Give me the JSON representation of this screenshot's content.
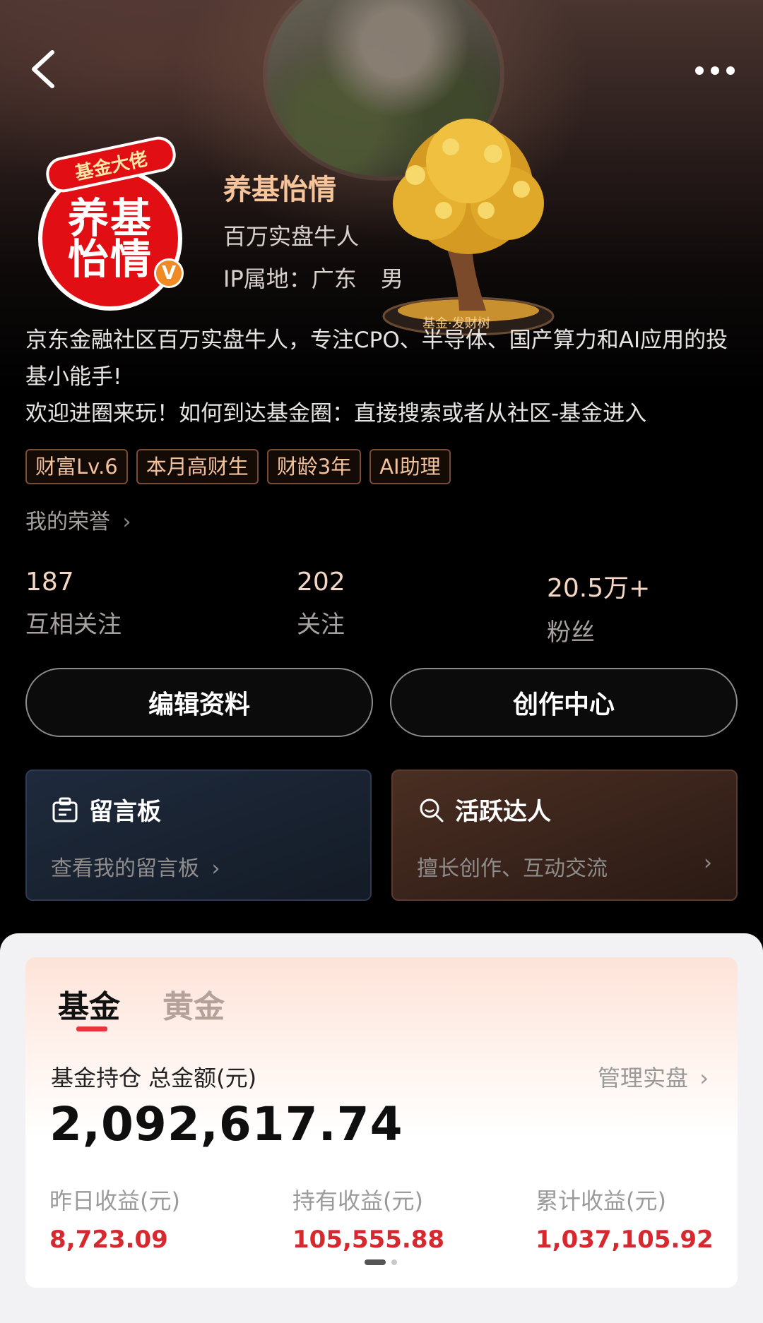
{
  "header": {
    "back_icon": "chevron-left-icon",
    "more_icon": "ellipsis-icon"
  },
  "avatar": {
    "ribbon_text": "基金大佬",
    "line1": "养基",
    "line2": "怡情",
    "verified_badge": "V"
  },
  "profile": {
    "nickname": "养基怡情",
    "subtitle": "百万实盘牛人",
    "ip_location": "IP属地：广东",
    "gender": "男"
  },
  "pendant": {
    "label": "基金·发财树"
  },
  "bio": {
    "line1": "京东金融社区百万实盘牛人，专注CPO、半导体、国产算力和AI应用的投基小能手!",
    "line2": "欢迎进圈来玩！如何到达基金圈：直接搜索或者从社区-基金进入"
  },
  "badges": [
    "财富Lv.6",
    "本月高财生",
    "财龄3年",
    "AI助理"
  ],
  "honor_link": "我的荣誉",
  "stats": [
    {
      "value": "187",
      "label": "互相关注"
    },
    {
      "value": "202",
      "label": "关注"
    },
    {
      "value": "20.5万+",
      "label": "粉丝"
    }
  ],
  "buttons": {
    "edit_profile": "编辑资料",
    "creator_center": "创作中心"
  },
  "cards": {
    "message_board": {
      "title": "留言板",
      "subtitle": "查看我的留言板",
      "icon": "message-board-icon"
    },
    "active_talent": {
      "title": "活跃达人",
      "subtitle": "擅长创作、互动交流",
      "icon": "search-badge-icon"
    }
  },
  "portfolio": {
    "tabs": [
      {
        "label": "基金",
        "active": true
      },
      {
        "label": "黄金",
        "active": false
      }
    ],
    "holding_label": "基金持仓 总金额(元)",
    "manage_label": "管理实盘",
    "total_amount": "2,092,617.74",
    "metrics": [
      {
        "label": "昨日收益(元)",
        "value": "8,723.09"
      },
      {
        "label": "持有收益(元)",
        "value": "105,555.88"
      },
      {
        "label": "累计收益(元)",
        "value": "1,037,105.92"
      }
    ]
  },
  "colors": {
    "accent_gold": "#f6c59c",
    "profit_red": "#d8282f",
    "badge_border": "#7a4a34"
  }
}
